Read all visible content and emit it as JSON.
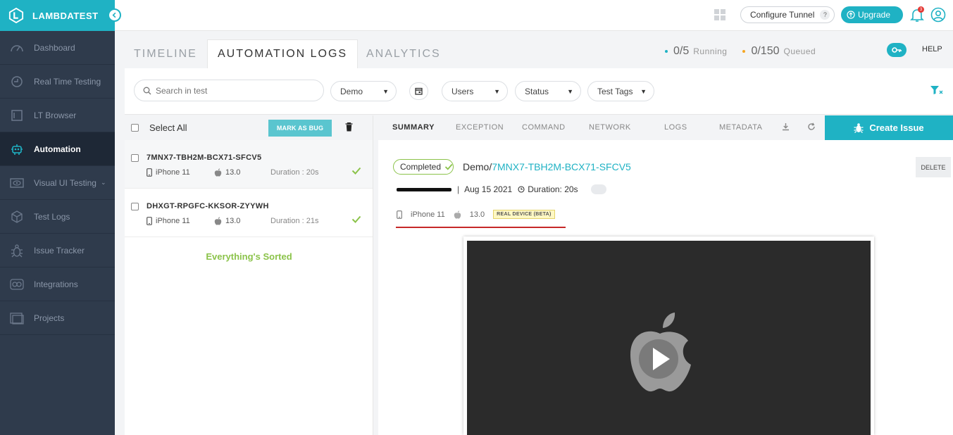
{
  "brand": {
    "name": "LAMBDATEST",
    "color": "#1fb2c4"
  },
  "sidebar": {
    "items": [
      {
        "label": "Dashboard",
        "icon": "gauge-icon"
      },
      {
        "label": "Real Time Testing",
        "icon": "clock-icon"
      },
      {
        "label": "LT Browser",
        "icon": "browser-icon"
      },
      {
        "label": "Automation",
        "icon": "robot-icon",
        "active": true
      },
      {
        "label": "Visual UI Testing",
        "icon": "eye-screen-icon",
        "chevron": "⌄"
      },
      {
        "label": "Test Logs",
        "icon": "cube-icon"
      },
      {
        "label": "Issue Tracker",
        "icon": "bug-icon"
      },
      {
        "label": "Integrations",
        "icon": "puzzle-icon"
      },
      {
        "label": "Projects",
        "icon": "folder-icon"
      }
    ]
  },
  "topbar": {
    "configure_tunnel": "Configure Tunnel",
    "tunnel_help": "?",
    "upgrade": "Upgrade",
    "notification_count": "3"
  },
  "tabs": {
    "items": [
      "TIMELINE",
      "AUTOMATION LOGS",
      "ANALYTICS"
    ],
    "running_count": "0/5",
    "running_label": "Running",
    "queued_count": "0/150",
    "queued_label": "Queued",
    "help": "HELP"
  },
  "filters": {
    "search_placeholder": "Search in test",
    "build": "Demo",
    "users": "Users",
    "status": "Status",
    "tags": "Test Tags"
  },
  "list": {
    "select_all": "Select All",
    "mark_bug": "MARK AS BUG",
    "tests": [
      {
        "id": "7MNX7-TBH2M-BCX71-SFCV5",
        "device": "iPhone 11",
        "os": "13.0",
        "duration": "Duration : 20s"
      },
      {
        "id": "DHXGT-RPGFC-KKSOR-ZYYWH",
        "device": "iPhone 11",
        "os": "13.0",
        "duration": "Duration : 21s"
      }
    ],
    "empty_msg": "Everything's Sorted"
  },
  "detail": {
    "tabs": [
      "SUMMARY",
      "EXCEPTION",
      "COMMAND",
      "NETWORK",
      "LOGS",
      "METADATA"
    ],
    "create_issue": "Create Issue",
    "status": "Completed",
    "build_name": "Demo/",
    "test_id": "7MNX7-TBH2M-BCX71-SFCV5",
    "delete": "DELETE",
    "sep": "|",
    "date": "Aug 15 2021",
    "duration": "Duration: 20s",
    "device": "iPhone 11",
    "os": "13.0",
    "real_device": "REAL DEVICE (BETA)"
  }
}
